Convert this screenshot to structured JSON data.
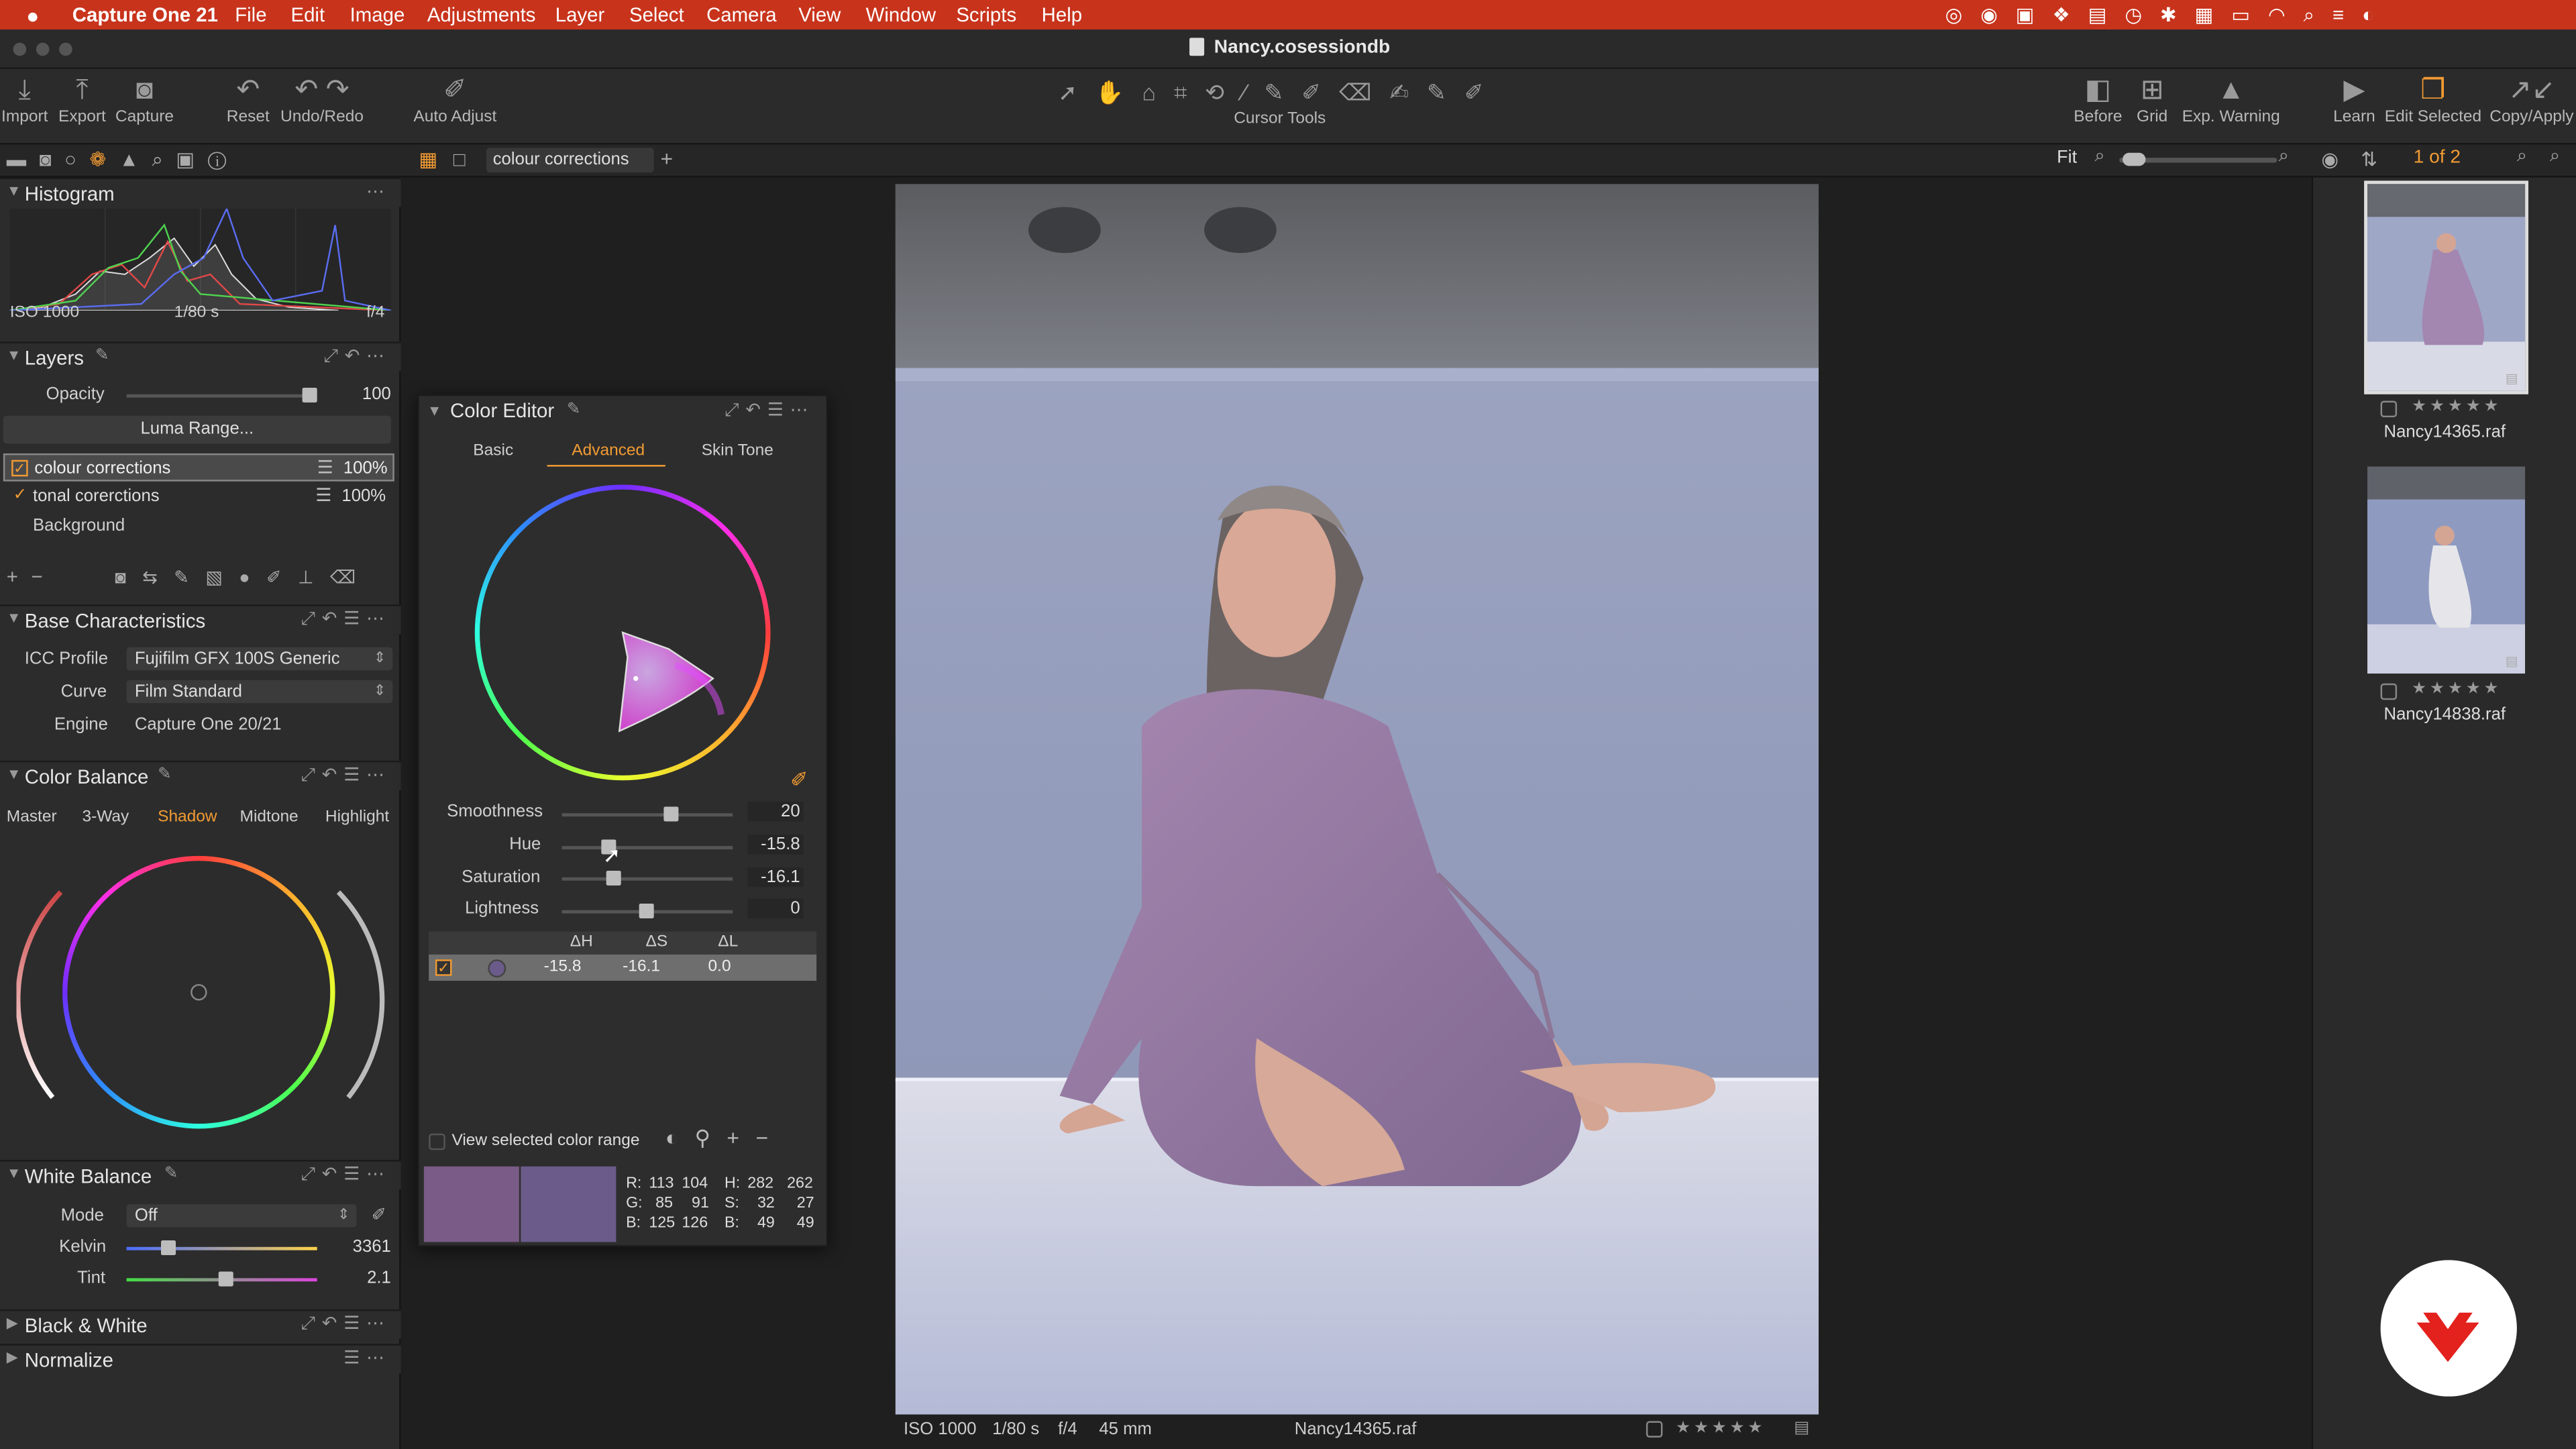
{
  "menubar": {
    "app": "Capture One 21",
    "items": [
      "File",
      "Edit",
      "Image",
      "Adjustments",
      "Layer",
      "Select",
      "Camera",
      "View",
      "Window",
      "Scripts",
      "Help"
    ]
  },
  "window": {
    "title": "Nancy.cosessiondb"
  },
  "toolbar": {
    "import": "Import",
    "export": "Export",
    "capture": "Capture",
    "reset": "Reset",
    "undo_redo": "Undo/Redo",
    "auto_adjust": "Auto Adjust",
    "cursor_tools": "Cursor Tools",
    "before": "Before",
    "grid": "Grid",
    "exp_warning": "Exp. Warning",
    "learn": "Learn",
    "edit_selected": "Edit Selected",
    "copy_apply": "Copy/Apply"
  },
  "viewer_bar": {
    "layer_select": "colour corrections",
    "fit": "Fit",
    "page_counter": "1 of 2"
  },
  "histogram": {
    "title": "Histogram",
    "iso": "ISO 1000",
    "shutter": "1/80 s",
    "aperture": "f/4"
  },
  "layers": {
    "title": "Layers",
    "opacity_label": "Opacity",
    "opacity_value": "100",
    "opacity_level": 1.0,
    "luma_button": "Luma Range...",
    "items": [
      {
        "name": "colour corrections",
        "pct": "100%"
      },
      {
        "name": "tonal corerctions",
        "pct": "100%"
      },
      {
        "name": "Background"
      }
    ]
  },
  "base": {
    "title": "Base Characteristics",
    "icc_label": "ICC Profile",
    "icc_value": "Fujifilm GFX 100S Generic",
    "curve_label": "Curve",
    "curve_value": "Film Standard",
    "engine_label": "Engine",
    "engine_value": "Capture One 20/21"
  },
  "color_balance": {
    "title": "Color Balance",
    "tabs": [
      "Master",
      "3-Way",
      "Shadow",
      "Midtone",
      "Highlight"
    ],
    "active_tab": "Shadow"
  },
  "white_balance": {
    "title": "White Balance",
    "mode_label": "Mode",
    "mode_value": "Off",
    "kelvin_label": "Kelvin",
    "kelvin_value": "3361",
    "tint_label": "Tint",
    "tint_value": "2.1"
  },
  "bw": {
    "title": "Black & White"
  },
  "normalize": {
    "title": "Normalize"
  },
  "color_editor": {
    "title": "Color Editor",
    "tabs": [
      "Basic",
      "Advanced",
      "Skin Tone"
    ],
    "active_tab": "Advanced",
    "sliders": [
      {
        "label": "Smoothness",
        "value": "20"
      },
      {
        "label": "Hue",
        "value": "-15.8"
      },
      {
        "label": "Saturation",
        "value": "-16.1"
      },
      {
        "label": "Lightness",
        "value": "0"
      }
    ],
    "table_headers": [
      "ΔH",
      "ΔS",
      "ΔL"
    ],
    "row": {
      "dh": "-15.8",
      "ds": "-16.1",
      "dl": "0.0"
    },
    "view_range": "View selected color range",
    "readout": {
      "r": "R:",
      "g": "G:",
      "b": "B:",
      "r1": "113",
      "r2": "104",
      "g1": "85",
      "g2": "91",
      "b1": "125",
      "b2": "126",
      "h": "H:",
      "s": "S:",
      "bl": "B:",
      "h1": "282",
      "h2": "262",
      "s1": "32",
      "s2": "27",
      "bv1": "49",
      "bv2": "49"
    },
    "swatch_before": "#7a5a86",
    "swatch_after": "#6b5b8a"
  },
  "statusbar": {
    "iso": "ISO 1000",
    "shutter": "1/80 s",
    "aperture": "f/4",
    "focal": "45 mm",
    "file": "Nancy14365.raf"
  },
  "thumbs": [
    {
      "name": "Nancy14365.raf"
    },
    {
      "name": "Nancy14838.raf"
    }
  ],
  "colors": {
    "accent": "#f29b33",
    "menubar": "#c8331c"
  }
}
